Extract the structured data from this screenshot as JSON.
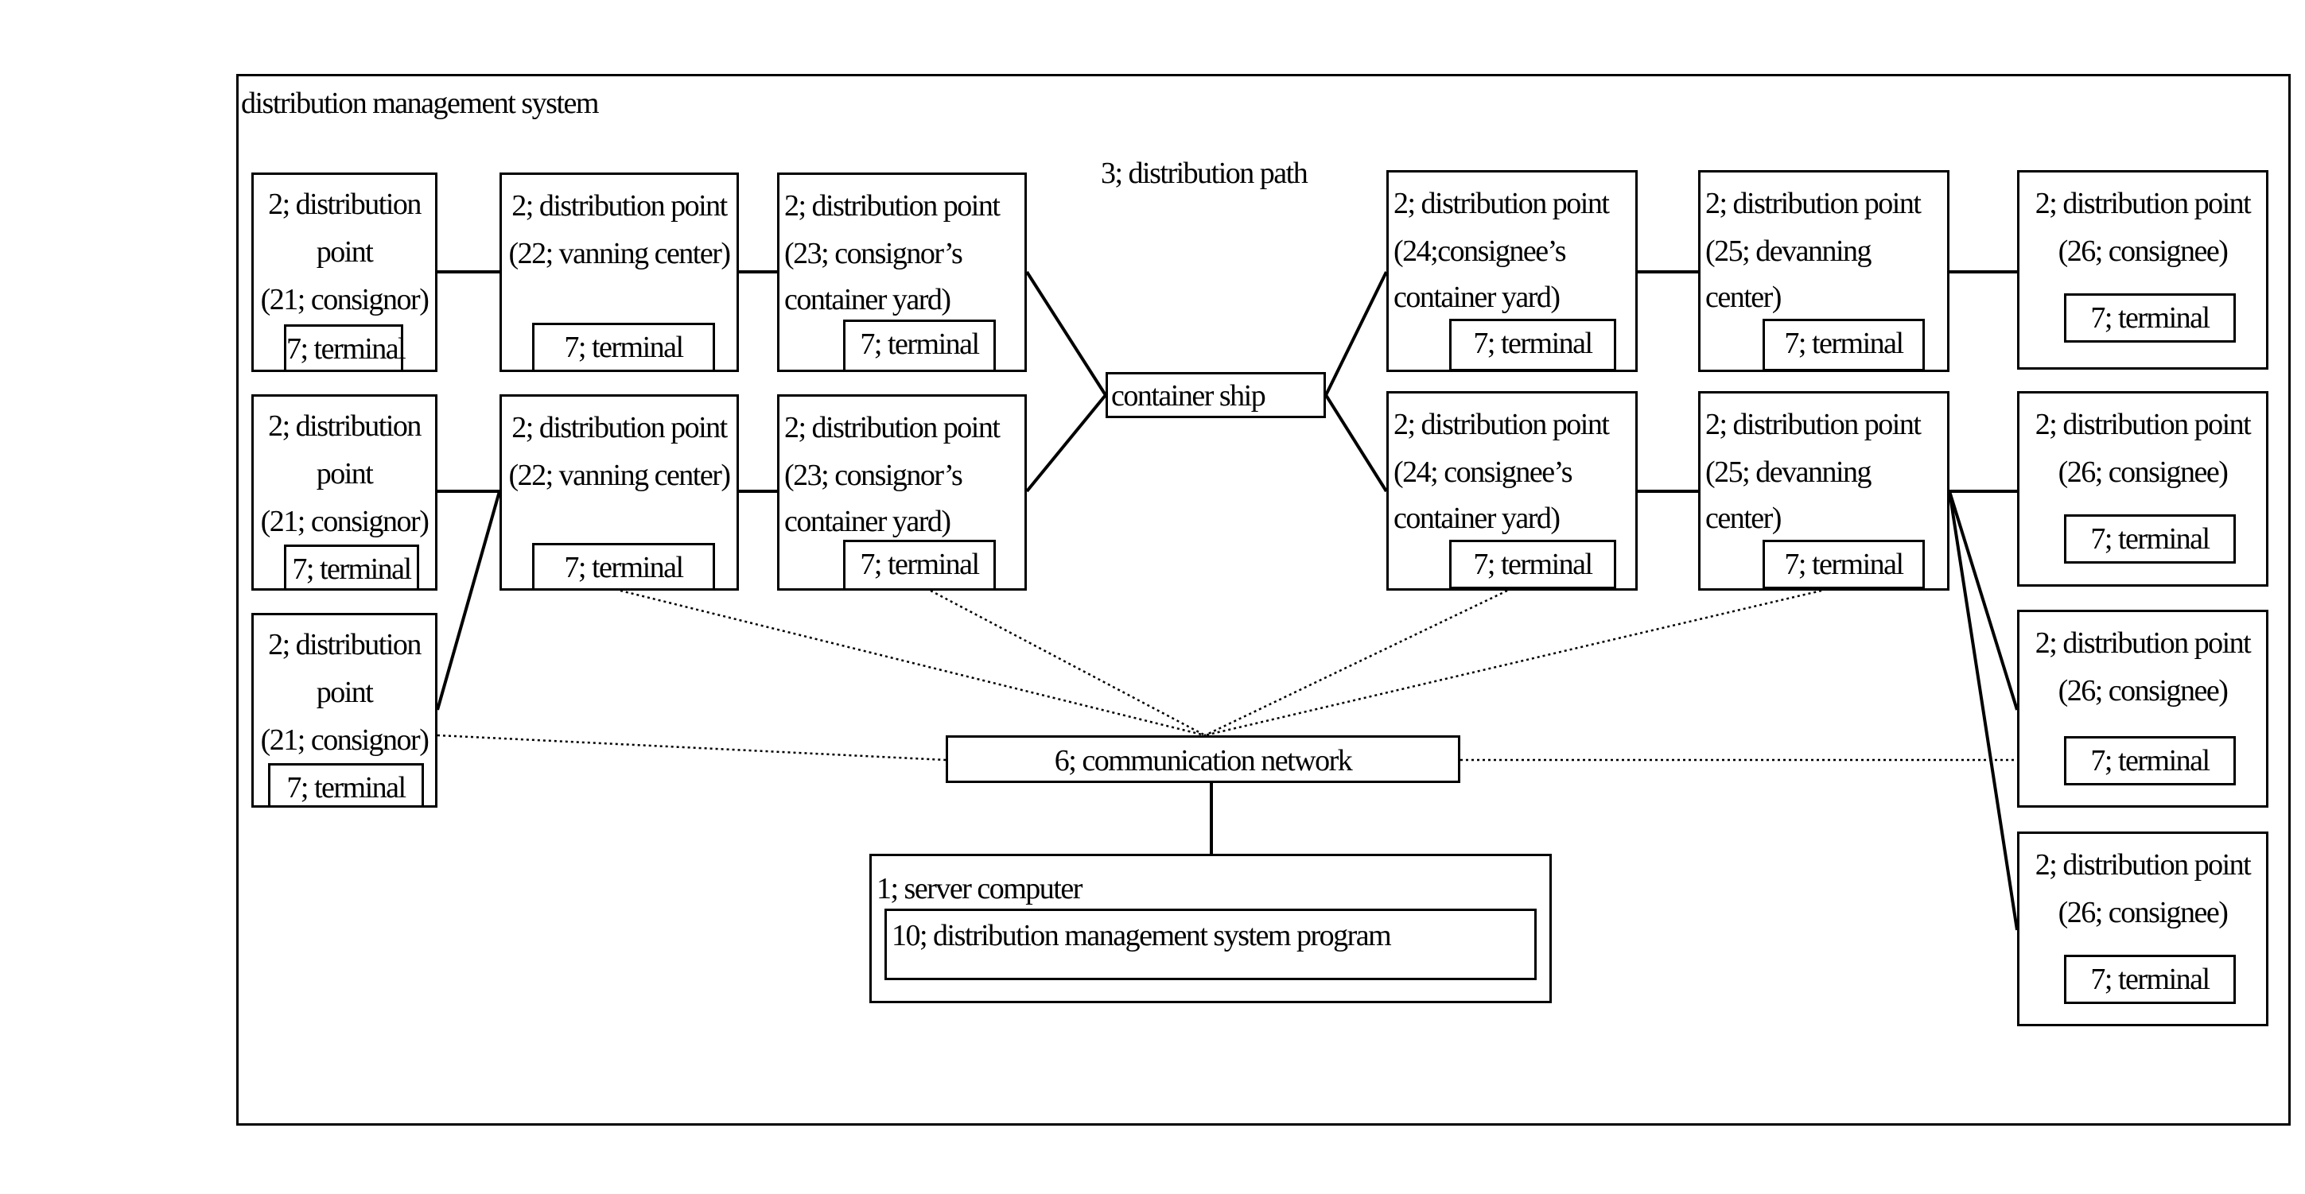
{
  "diagram": {
    "title": "distribution management system",
    "path_label": "3; distribution path",
    "container_ship": "container ship",
    "network": "6; communication network",
    "server": {
      "label": "1; server computer",
      "program": "10; distribution management system program"
    },
    "terminal_label": "7; terminal",
    "nodes": {
      "consignor_1": [
        "2; distribution",
        "point",
        "(21; consignor)"
      ],
      "consignor_2": [
        "2; distribution",
        "point",
        "(21; consignor)"
      ],
      "consignor_3": [
        "2; distribution",
        "point",
        "(21; consignor)"
      ],
      "vanning_1": [
        "2; distribution point",
        "(22; vanning center)"
      ],
      "vanning_2": [
        "2; distribution point",
        "(22; vanning center)"
      ],
      "consignor_yard_1": [
        "2; distribution point",
        "(23; consignor’s",
        "container yard)"
      ],
      "consignor_yard_2": [
        "2; distribution point",
        "(23; consignor’s",
        "container yard)"
      ],
      "consignee_yard_1": [
        "2; distribution point",
        "(24;consignee’s",
        "container yard)"
      ],
      "consignee_yard_2": [
        "2; distribution point",
        "(24; consignee’s",
        "container yard)"
      ],
      "devanning_1": [
        "2; distribution point",
        "(25; devanning",
        "center)"
      ],
      "devanning_2": [
        "2; distribution point",
        "(25; devanning",
        "center)"
      ],
      "consignee_1": [
        "2; distribution point",
        "(26; consignee)"
      ],
      "consignee_2": [
        "2; distribution point",
        "(26; consignee)"
      ],
      "consignee_3": [
        "2; distribution point",
        "(26; consignee)"
      ],
      "consignee_4": [
        "2; distribution point",
        "(26; consignee)"
      ]
    },
    "connections": {
      "physical": [
        [
          "consignor_1",
          "vanning_1"
        ],
        [
          "vanning_1",
          "consignor_yard_1"
        ],
        [
          "consignor_yard_1",
          "container_ship"
        ],
        [
          "consignor_2",
          "vanning_2"
        ],
        [
          "consignor_3",
          "vanning_2"
        ],
        [
          "vanning_2",
          "consignor_yard_2"
        ],
        [
          "consignor_yard_2",
          "container_ship"
        ],
        [
          "container_ship",
          "consignee_yard_1"
        ],
        [
          "consignee_yard_1",
          "devanning_1"
        ],
        [
          "devanning_1",
          "consignee_1"
        ],
        [
          "container_ship",
          "consignee_yard_2"
        ],
        [
          "consignee_yard_2",
          "devanning_2"
        ],
        [
          "devanning_2",
          "consignee_2"
        ],
        [
          "devanning_2",
          "consignee_3"
        ],
        [
          "devanning_2",
          "consignee_4"
        ],
        [
          "network",
          "server"
        ]
      ],
      "communication": [
        [
          "vanning_2",
          "network"
        ],
        [
          "consignor_yard_2",
          "network"
        ],
        [
          "consignee_yard_2",
          "network"
        ],
        [
          "devanning_2",
          "network"
        ],
        [
          "consignor_3",
          "network"
        ],
        [
          "consignee_3",
          "network"
        ]
      ]
    }
  }
}
